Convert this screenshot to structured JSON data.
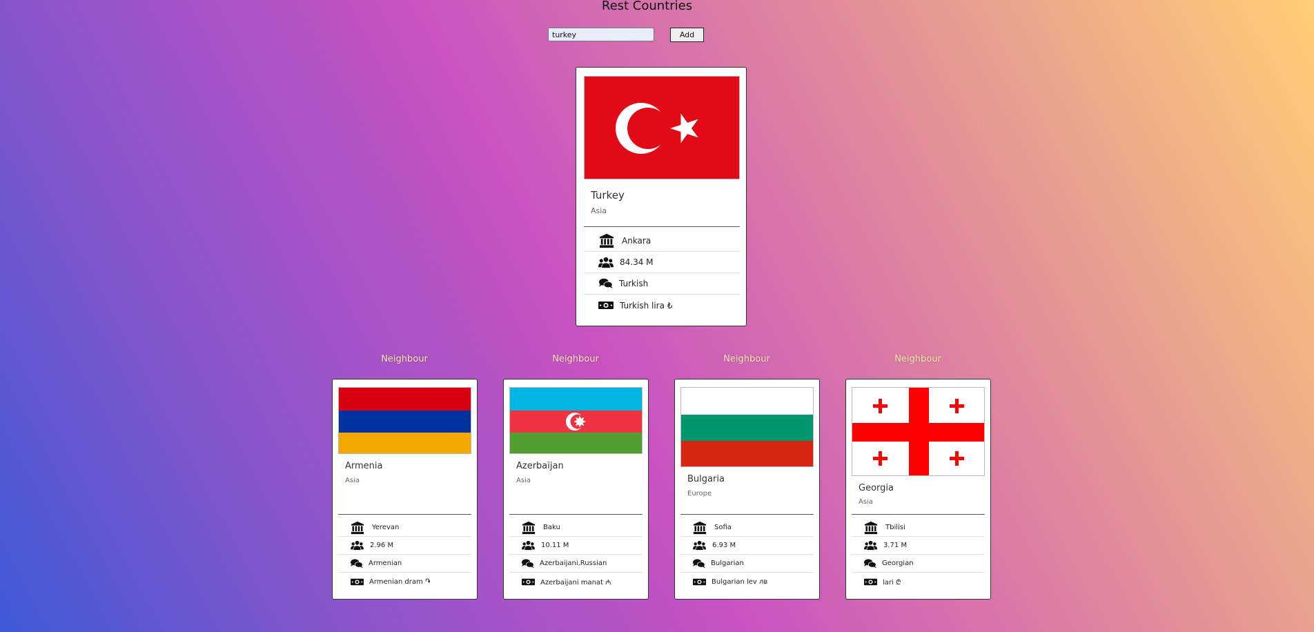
{
  "app": {
    "title": "Rest Countries"
  },
  "search": {
    "value": "turkey",
    "add_label": "Add"
  },
  "main_country": {
    "name": "Turkey",
    "region": "Asia",
    "capital": "Ankara",
    "population": "84.34 M",
    "language": "Turkish",
    "currency": "Turkish lira ₺"
  },
  "neighbour_label": "Neighbour",
  "neighbours": [
    {
      "name": "Armenia",
      "region": "Asia",
      "capital": "Yerevan",
      "population": "2.96 M",
      "language": "Armenian",
      "currency": "Armenian dram ֏"
    },
    {
      "name": "Azerbaijan",
      "region": "Asia",
      "capital": "Baku",
      "population": "10.11 M",
      "language": "Azerbaijani,Russian",
      "currency": "Azerbaijani manat ₼"
    },
    {
      "name": "Bulgaria",
      "region": "Europe",
      "capital": "Sofia",
      "population": "6.93 M",
      "language": "Bulgarian",
      "currency": "Bulgarian lev лв"
    },
    {
      "name": "Georgia",
      "region": "Asia",
      "capital": "Tbilisi",
      "population": "3.71 M",
      "language": "Georgian",
      "currency": "lari ₾"
    }
  ],
  "icons": [
    "capital-icon",
    "population-icon",
    "language-icon",
    "currency-icon"
  ],
  "colors": {
    "turkey_red": "#e30a17",
    "armenia": [
      "#d90012",
      "#0033a0",
      "#f2a800"
    ],
    "azerbaijan": [
      "#00b5e2",
      "#ef3340",
      "#509e2f"
    ],
    "bulgaria": [
      "#ffffff",
      "#00966e",
      "#d62612"
    ],
    "georgia_red": "#ff0000"
  }
}
